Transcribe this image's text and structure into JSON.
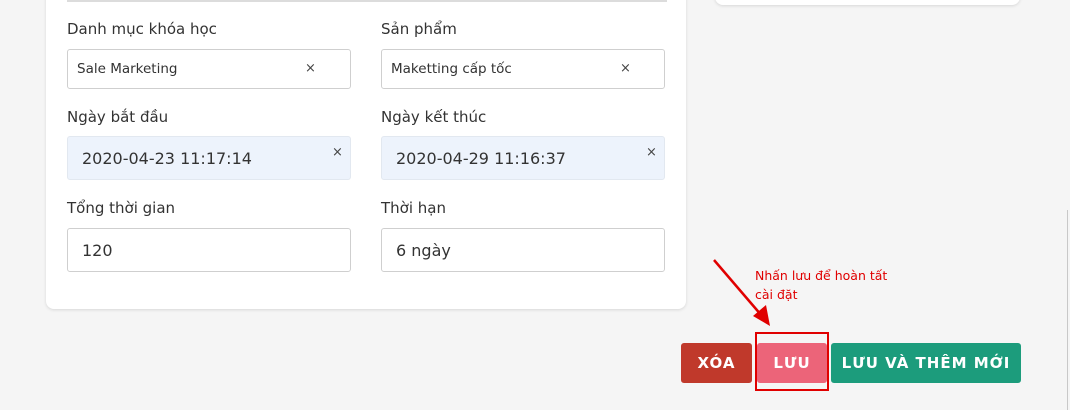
{
  "form": {
    "category_label": "Danh mục khóa học",
    "category_value": "Sale Marketing",
    "product_label": "Sản phẩm",
    "product_value": "Maketting cấp tốc",
    "start_label": "Ngày bắt đầu",
    "start_value": "2020-04-23 11:17:14",
    "end_label": "Ngày kết thúc",
    "end_value": "2020-04-29 11:16:37",
    "total_label": "Tổng thời gian",
    "total_value": "120",
    "term_label": "Thời hạn",
    "term_value": "6 ngày",
    "clear_glyph": "×"
  },
  "actions": {
    "delete_label": "XÓA",
    "save_label": "LƯU",
    "save_new_label": "LƯU VÀ THÊM MỚI",
    "delete_color": "#c0392b",
    "save_color": "#ec6479",
    "save_new_color": "#1c9c7c"
  },
  "annotation": {
    "line1": "Nhấn lưu để hoàn tất",
    "line2": "cài đặt",
    "color": "#e00000"
  }
}
